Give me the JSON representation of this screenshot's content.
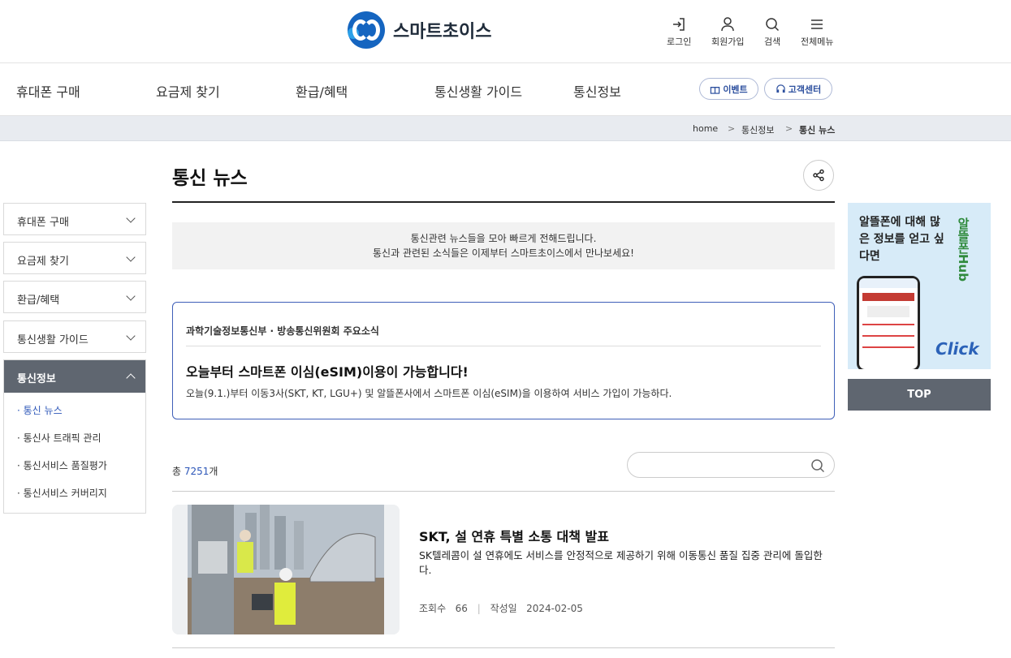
{
  "header": {
    "brand": "스마트초이스",
    "util": [
      {
        "label": "로그인",
        "icon": "login-icon"
      },
      {
        "label": "회원가입",
        "icon": "user-icon"
      },
      {
        "label": "검색",
        "icon": "search-icon"
      },
      {
        "label": "전체메뉴",
        "icon": "menu-icon"
      }
    ]
  },
  "gnb": {
    "items": [
      "휴대폰 구매",
      "요금제 찾기",
      "환급/혜택",
      "통신생활 가이드",
      "통신정보"
    ],
    "event_label": "이벤트",
    "cs_label": "고객센터"
  },
  "breadcrumb": [
    "home",
    "통신정보",
    "통신 뉴스"
  ],
  "sidebar": {
    "items": [
      "휴대폰 구매",
      "요금제 찾기",
      "환급/혜택",
      "통신생활 가이드"
    ],
    "active": "통신정보",
    "sub_items": [
      "통신 뉴스",
      "통신사 트래픽 관리",
      "통신서비스 품질평가",
      "통신서비스 커버리지"
    ]
  },
  "page": {
    "title": "통신 뉴스",
    "intro_line1": "통신관련 뉴스들을 모아 빠르게 전해드립니다.",
    "intro_line2": "통신과 관련된 소식들은 이제부터 스마트초이스에서 만나보세요!"
  },
  "notice": {
    "org": "과학기술정보통신부 · 방송통신위원회 주요소식",
    "headline": "오늘부터 스마트폰 이심(eSIM)이용이 가능합니다!",
    "body": "오늘(9.1.)부터 이동3사(SKT, KT, LGU+) 및 알뜰폰사에서 스마트폰 이심(eSIM)을 이용하여 서비스 가입이 가능하다."
  },
  "list": {
    "total_prefix": "총",
    "total_count": "7251",
    "total_suffix": "개",
    "search_placeholder": ""
  },
  "article": {
    "title": "SKT, 설 연휴 특별 소통 대책 발표",
    "desc": "SK텔레콤이 설 연휴에도 서비스를 안정적으로 제공하기 위해 이동통신 품질 집중 관리에 돌입한다.",
    "views_label": "조회수",
    "views": "66",
    "date_label": "작성일",
    "date": "2024-02-05"
  },
  "banner": {
    "text": "알뜰폰에 대해 많은 정보를 얻고 싶다면",
    "brand": "알뜰폰Hub",
    "click": "Click"
  },
  "top_button": "TOP",
  "colors": {
    "accent": "#2c56b8",
    "dark_gray": "#5f6670",
    "breadcrumb_bg": "#e8ebf0"
  }
}
